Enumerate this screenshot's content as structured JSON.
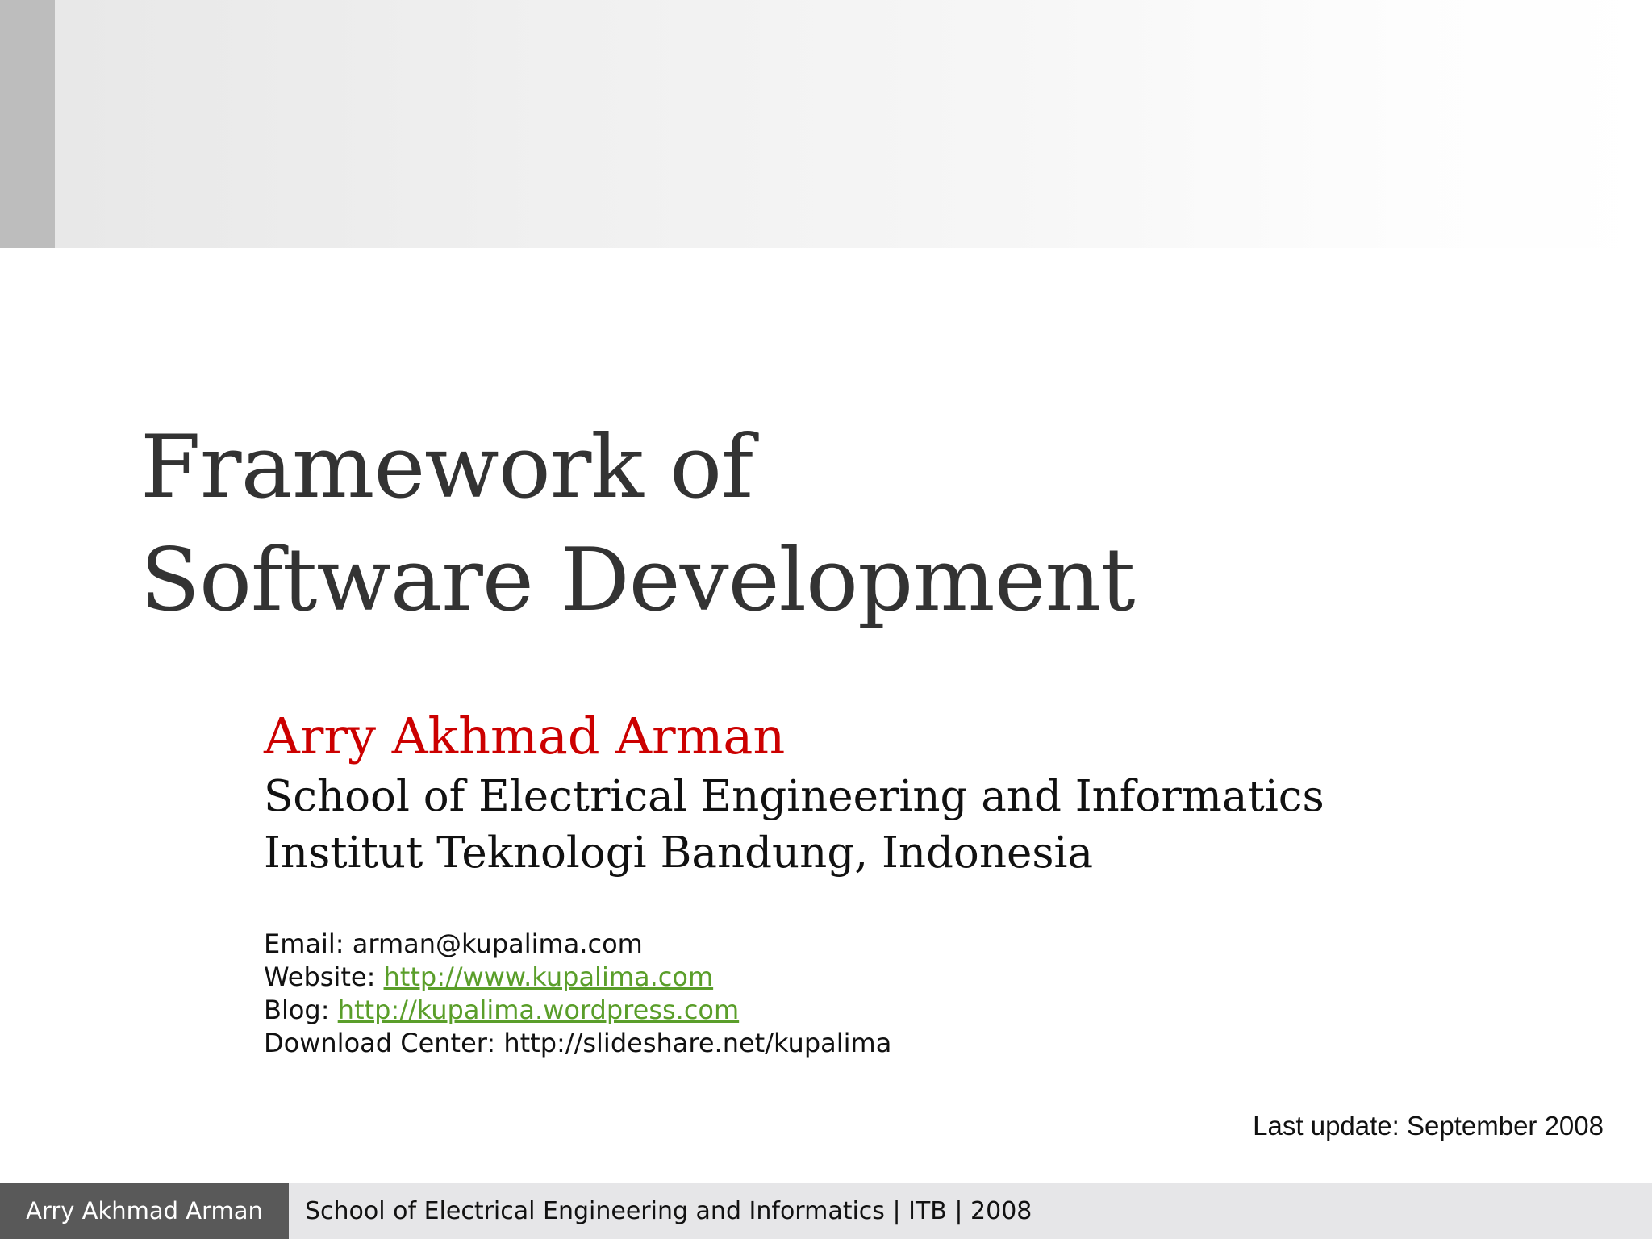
{
  "slide": {
    "title_line1": "Framework of",
    "title_line2": "Software Development",
    "author": "Arry Akhmad Arman",
    "affiliation_line1": "School of Electrical Engineering and Informatics",
    "affiliation_line2": "Institut Teknologi Bandung, Indonesia",
    "contacts": {
      "email_label": "Email:",
      "email_value": "arman@kupalima.com",
      "website_label": "Website:",
      "website_value": "http://www.kupalima.com",
      "blog_label": "Blog:",
      "blog_value": "http://kupalima.wordpress.com",
      "download_label": "Download Center:",
      "download_value": "http://slideshare.net/kupalima"
    },
    "last_update": "Last update: September 2008"
  },
  "footer": {
    "left_text": "Arry Akhmad Arman",
    "right_text": "School of Electrical Engineering and Informatics | ITB | 2008"
  },
  "colors": {
    "author_red": "#cc0000",
    "link_green": "#5a9e2a",
    "footer_dark": "#595959",
    "footer_light": "#e6e6e8",
    "title_gray": "#333333"
  }
}
